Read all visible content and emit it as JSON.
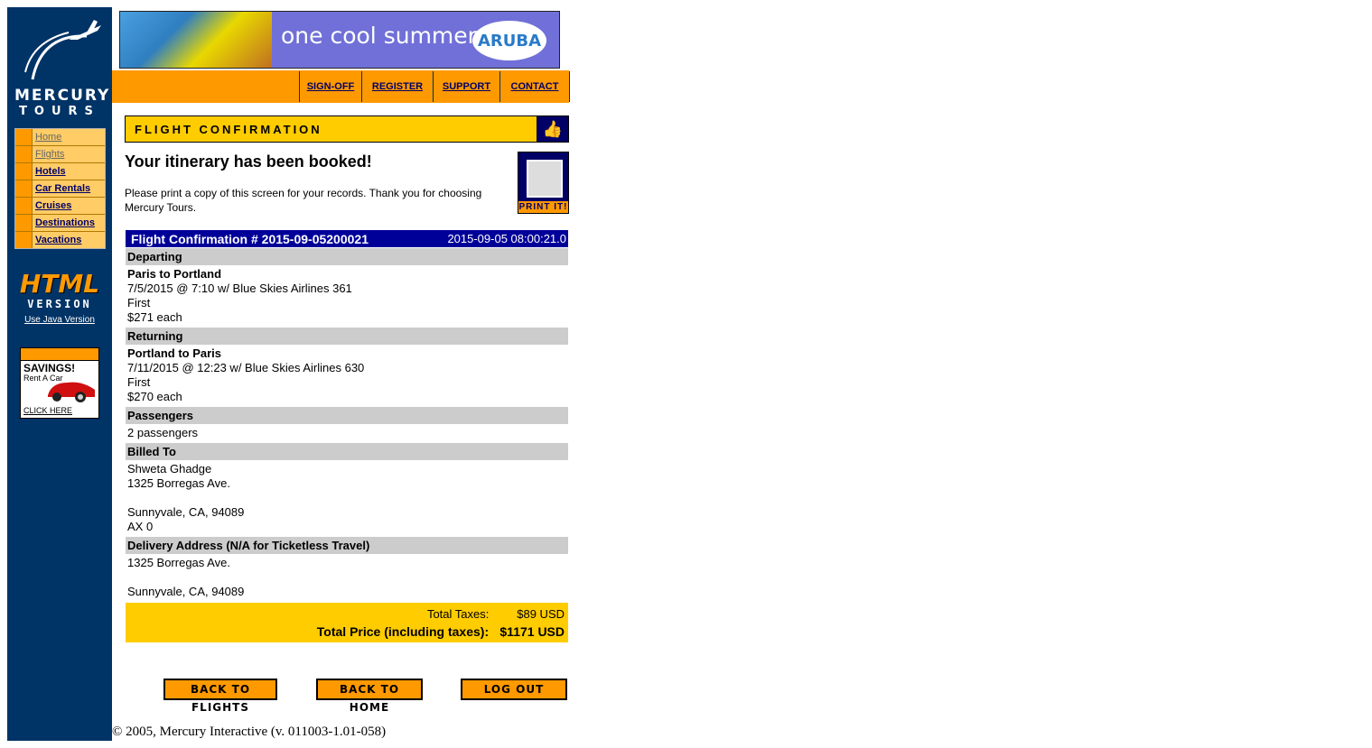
{
  "brand": {
    "line1": "MERCURY",
    "line2": "TOURS"
  },
  "banner": {
    "tagline": "one cool summer",
    "logo_text": "ARUBA"
  },
  "sidebar": {
    "items": [
      {
        "label": "Home",
        "active": false
      },
      {
        "label": "Flights",
        "active": false
      },
      {
        "label": "Hotels",
        "active": true
      },
      {
        "label": "Car Rentals",
        "active": true
      },
      {
        "label": "Cruises",
        "active": true
      },
      {
        "label": "Destinations",
        "active": true
      },
      {
        "label": "Vacations",
        "active": true
      }
    ],
    "html_version": {
      "line1": "HTML",
      "line2": "VERSION",
      "link": "Use Java Version"
    },
    "ad": {
      "title": "SAVINGS!",
      "subtitle": "Rent A Car",
      "cta": "CLICK HERE"
    }
  },
  "topnav": [
    "SIGN-OFF",
    "REGISTER",
    "SUPPORT",
    "CONTACT"
  ],
  "page": {
    "title": "FLIGHT CONFIRMATION",
    "heading": "Your itinerary has been booked!",
    "note": "Please print a copy of this screen for your records. Thank you for choosing Mercury Tours.",
    "print_label": "PRINT IT!"
  },
  "confirmation": {
    "header": "Flight Confirmation # 2015-09-05200021",
    "timestamp": "2015-09-05 08:00:21.0",
    "departing": {
      "label": "Departing",
      "route": "Paris to Portland",
      "detail": "7/5/2015 @ 7:10 w/ Blue Skies Airlines 361",
      "class": "First",
      "price": "$271 each"
    },
    "returning": {
      "label": "Returning",
      "route": "Portland to Paris",
      "detail": "7/11/2015 @ 12:23 w/ Blue Skies Airlines 630",
      "class": "First",
      "price": "$270 each"
    },
    "passengers": {
      "label": "Passengers",
      "value": "2 passengers"
    },
    "billed_to": {
      "label": "Billed To",
      "name": "Shweta Ghadge",
      "address1": "1325 Borregas Ave.",
      "city": "Sunnyvale, CA, 94089",
      "extra": "AX 0"
    },
    "delivery": {
      "label": "Delivery Address (N/A for Ticketless Travel)",
      "address1": "1325 Borregas Ave.",
      "city": "Sunnyvale, CA, 94089"
    },
    "totals": {
      "taxes_label": "Total Taxes:",
      "taxes_value": "$89 USD",
      "total_label": "Total Price (including taxes):",
      "total_value": "$1171 USD"
    }
  },
  "buttons": {
    "back_flights": "BACK TO FLIGHTS",
    "back_home": "BACK TO HOME",
    "logout": "LOG OUT"
  },
  "footer": "© 2005, Mercury Interactive (v. 011003-1.01-058)",
  "colors": {
    "sidebar_bg": "#003366",
    "accent_orange": "#ff9900",
    "yellow": "#ffcc00",
    "header_blue": "#000099"
  }
}
